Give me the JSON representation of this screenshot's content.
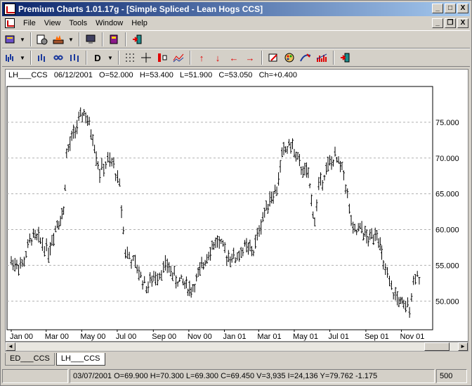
{
  "window": {
    "title": "Premium Charts 1.01.17g - [Simple Spliced  -  Lean Hogs CCS]",
    "minimize": "_",
    "maximize": "□",
    "close": "X"
  },
  "menu": {
    "items": [
      "File",
      "View",
      "Tools",
      "Window",
      "Help"
    ],
    "mdi_minimize": "_",
    "mdi_restore": "❐",
    "mdi_close": "X"
  },
  "toolbar2": {
    "period_label": "D"
  },
  "chart_header": {
    "symbol": "LH___CCS",
    "date": "06/12/2001",
    "open": "O=52.000",
    "high": "H=53.400",
    "low": "L=51.900",
    "close": "C=53.050",
    "change": "Ch=+0.400"
  },
  "chart_data": {
    "type": "bar",
    "subtype": "ohlc",
    "series": [
      {
        "values": [
          {
            "x": "2000-01-01",
            "y": 55.5
          },
          {
            "x": "2000-01-20",
            "y": 55.0
          },
          {
            "x": "2000-02-05",
            "y": 59.0
          },
          {
            "x": "2000-02-20",
            "y": 58.5
          },
          {
            "x": "2000-03-05",
            "y": 57.0
          },
          {
            "x": "2000-03-20",
            "y": 61.0
          },
          {
            "x": "2000-03-31",
            "y": 62.5
          },
          {
            "x": "2000-04-05",
            "y": 70.5
          },
          {
            "x": "2000-04-20",
            "y": 74.0
          },
          {
            "x": "2000-05-05",
            "y": 76.5
          },
          {
            "x": "2000-05-20",
            "y": 73.0
          },
          {
            "x": "2000-06-01",
            "y": 68.0
          },
          {
            "x": "2000-06-15",
            "y": 69.5
          },
          {
            "x": "2000-06-25",
            "y": 69.0
          },
          {
            "x": "2000-07-05",
            "y": 66.0
          },
          {
            "x": "2000-07-15",
            "y": 57.0
          },
          {
            "x": "2000-08-01",
            "y": 55.0
          },
          {
            "x": "2000-08-20",
            "y": 52.0
          },
          {
            "x": "2000-09-05",
            "y": 53.5
          },
          {
            "x": "2000-09-25",
            "y": 55.0
          },
          {
            "x": "2000-10-10",
            "y": 53.0
          },
          {
            "x": "2000-10-25",
            "y": 52.5
          },
          {
            "x": "2000-11-05",
            "y": 51.5
          },
          {
            "x": "2000-11-20",
            "y": 54.0
          },
          {
            "x": "2000-12-05",
            "y": 57.0
          },
          {
            "x": "2000-12-20",
            "y": 58.5
          },
          {
            "x": "2001-01-05",
            "y": 56.5
          },
          {
            "x": "2001-01-20",
            "y": 56.0
          },
          {
            "x": "2001-02-05",
            "y": 57.5
          },
          {
            "x": "2001-02-20",
            "y": 57.0
          },
          {
            "x": "2001-03-05",
            "y": 61.0
          },
          {
            "x": "2001-03-20",
            "y": 64.5
          },
          {
            "x": "2001-04-01",
            "y": 65.5
          },
          {
            "x": "2001-04-10",
            "y": 70.5
          },
          {
            "x": "2001-04-25",
            "y": 72.0
          },
          {
            "x": "2001-05-10",
            "y": 69.0
          },
          {
            "x": "2001-05-25",
            "y": 67.5
          },
          {
            "x": "2001-06-05",
            "y": 61.0
          },
          {
            "x": "2001-06-12",
            "y": 66.0
          },
          {
            "x": "2001-06-25",
            "y": 68.5
          },
          {
            "x": "2001-07-10",
            "y": 70.0
          },
          {
            "x": "2001-07-25",
            "y": 68.0
          },
          {
            "x": "2001-08-10",
            "y": 59.5
          },
          {
            "x": "2001-08-25",
            "y": 60.0
          },
          {
            "x": "2001-09-05",
            "y": 58.5
          },
          {
            "x": "2001-09-20",
            "y": 60.0
          },
          {
            "x": "2001-10-01",
            "y": 55.0
          },
          {
            "x": "2001-10-15",
            "y": 51.5
          },
          {
            "x": "2001-10-25",
            "y": 50.5
          },
          {
            "x": "2001-11-05",
            "y": 49.0
          },
          {
            "x": "2001-11-15",
            "y": 49.5
          },
          {
            "x": "2001-11-25",
            "y": 54.0
          },
          {
            "x": "2001-12-05",
            "y": 53.0
          }
        ]
      }
    ],
    "x_tick_labels": [
      "Jan 00",
      "Mar 00",
      "May 00",
      "Jul 00",
      "Sep 00",
      "Nov 00",
      "Jan 01",
      "Mar 01",
      "May 01",
      "Jul 01",
      "Sep 01",
      "Nov 01"
    ],
    "y_tick_labels": [
      "75.000",
      "70.000",
      "65.000",
      "60.000",
      "55.000",
      "50.000"
    ],
    "ylim": [
      46,
      80
    ],
    "grid": true
  },
  "scrollbar": {
    "left_arrow": "◄",
    "right_arrow": "►"
  },
  "tabs": [
    "ED___CCS",
    "LH___CCS"
  ],
  "status": {
    "empty": "",
    "cursor_info": "03/07/2001  O=69.900  H=70.300  L=69.300  C=69.450  V=3,935  I=24,136  Y=79.762  -1.175",
    "bars": "500"
  }
}
